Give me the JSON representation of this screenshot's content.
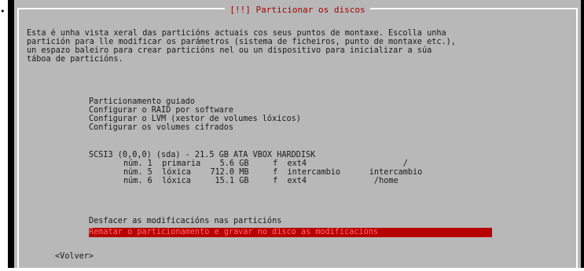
{
  "bullet": "•",
  "dialog": {
    "title": "[!!] Particionar os discos",
    "intro": [
      "Esta é unha vista xeral das particións actuais cos seus puntos de montaxe. Escolla unha",
      "partición para lle modificar os parámetros (sistema de ficheiros, punto de montaxe etc.),",
      "un espazo baleiro para crear particións nel ou un dispositivo para inicializar a súa",
      "táboa de particións."
    ]
  },
  "menu": {
    "guided": "Particionamento guiado",
    "raid": "Configurar o RAID por software",
    "lvm": "Configurar o LVM (xestor de volumes lóxicos)",
    "crypto": "Configurar os volumes cifrados",
    "disk": "SCSI3 (0,0,0) (sda) - 21.5 GB ATA VBOX HARDDISK",
    "partitions": [
      {
        "row": "núm. 1  primaria    5.6 GB     f  ext4                    /"
      },
      {
        "row": "núm. 5  lóxica    712.0 MB     f  intercambio      intercambio"
      },
      {
        "row": "núm. 6  lóxica     15.1 GB     f  ext4              /home"
      }
    ],
    "undo": "Desfacer as modificacións nas particións",
    "finish": "Rematar o particionamento e gravar no disco as modificacións"
  },
  "footer": {
    "back": "<Volver>"
  },
  "colors": {
    "background": "#000000",
    "dialog": "#b8b8b8",
    "frame": "#ffffff",
    "title": "#a80000",
    "highlight": "#b80000",
    "highlight_text": "#ff6a6a"
  }
}
